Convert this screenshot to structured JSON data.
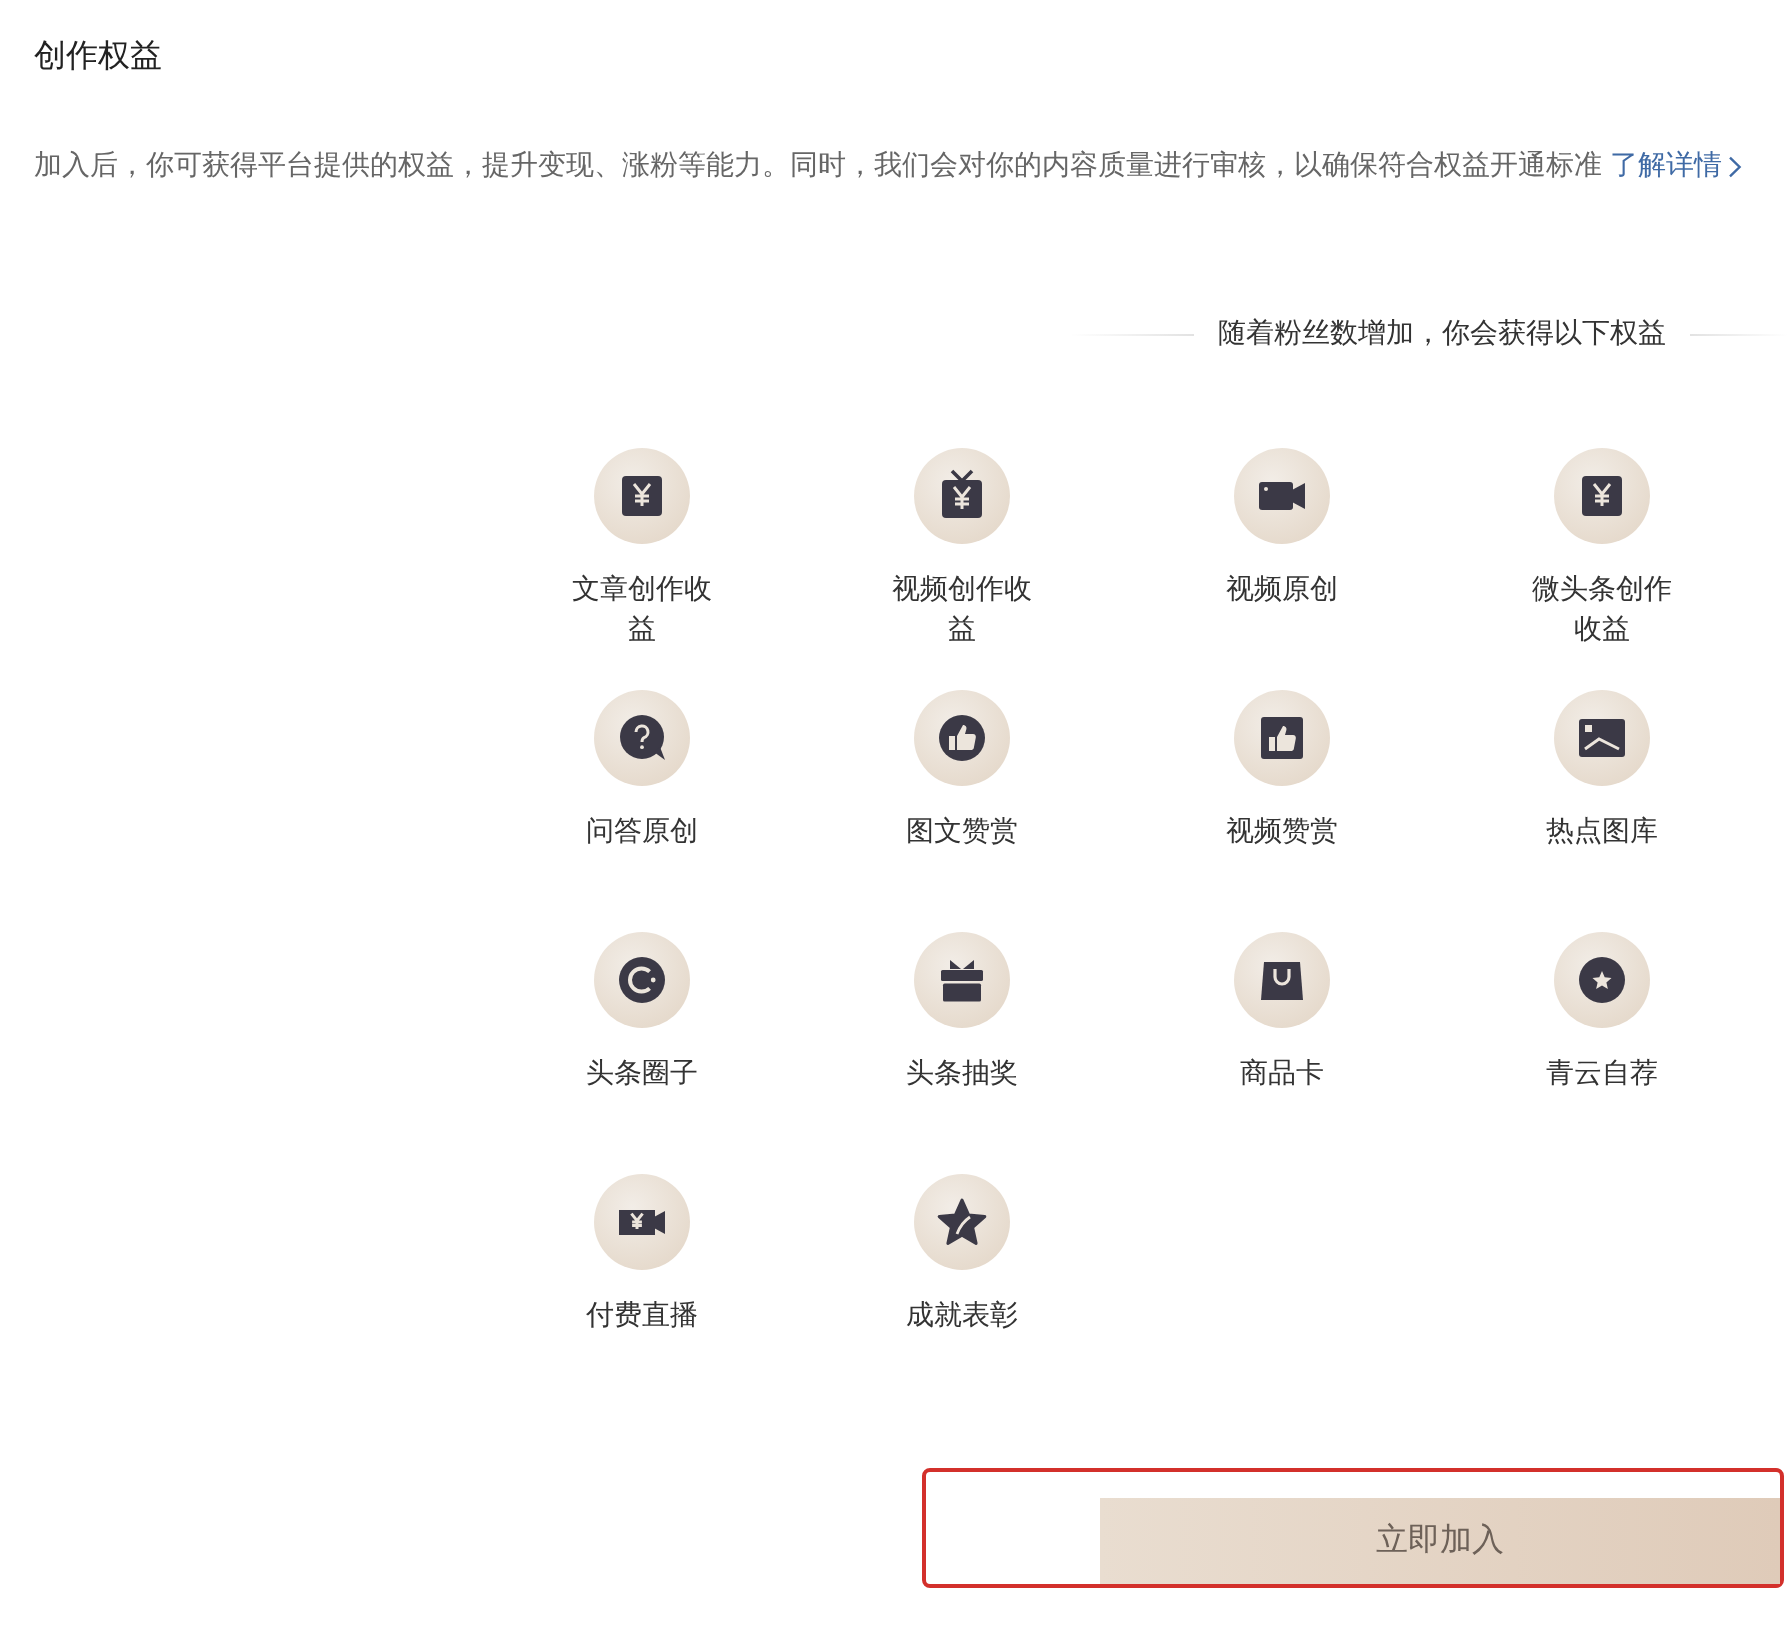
{
  "section_title": "创作权益",
  "description": {
    "text": "加入后，你可获得平台提供的权益，提升变现、涨粉等能力。同时，我们会对你的内容质量进行审核，以确保符合权益开通标准",
    "link": "了解详情"
  },
  "benefits_header": "随着粉丝数增加，你会获得以下权益",
  "benefits": [
    {
      "kind": "yen-card",
      "label": "文章创作收益"
    },
    {
      "kind": "yen-tv",
      "label": "视频创作收益"
    },
    {
      "kind": "camera",
      "label": "视频原创"
    },
    {
      "kind": "yen-card",
      "label": "微头条创作收益"
    },
    {
      "kind": "question",
      "label": "问答原创"
    },
    {
      "kind": "thumb-circle",
      "label": "图文赞赏"
    },
    {
      "kind": "thumb-square",
      "label": "视频赞赏"
    },
    {
      "kind": "picture",
      "label": "热点图库"
    },
    {
      "kind": "ring",
      "label": "头条圈子"
    },
    {
      "kind": "gift",
      "label": "头条抽奖"
    },
    {
      "kind": "bag",
      "label": "商品卡"
    },
    {
      "kind": "star-circle",
      "label": "青云自荐"
    },
    {
      "kind": "yen-camera",
      "label": "付费直播"
    },
    {
      "kind": "star",
      "label": "成就表彰"
    }
  ],
  "join_button": {
    "label": "立即加入",
    "highlighted": true
  }
}
